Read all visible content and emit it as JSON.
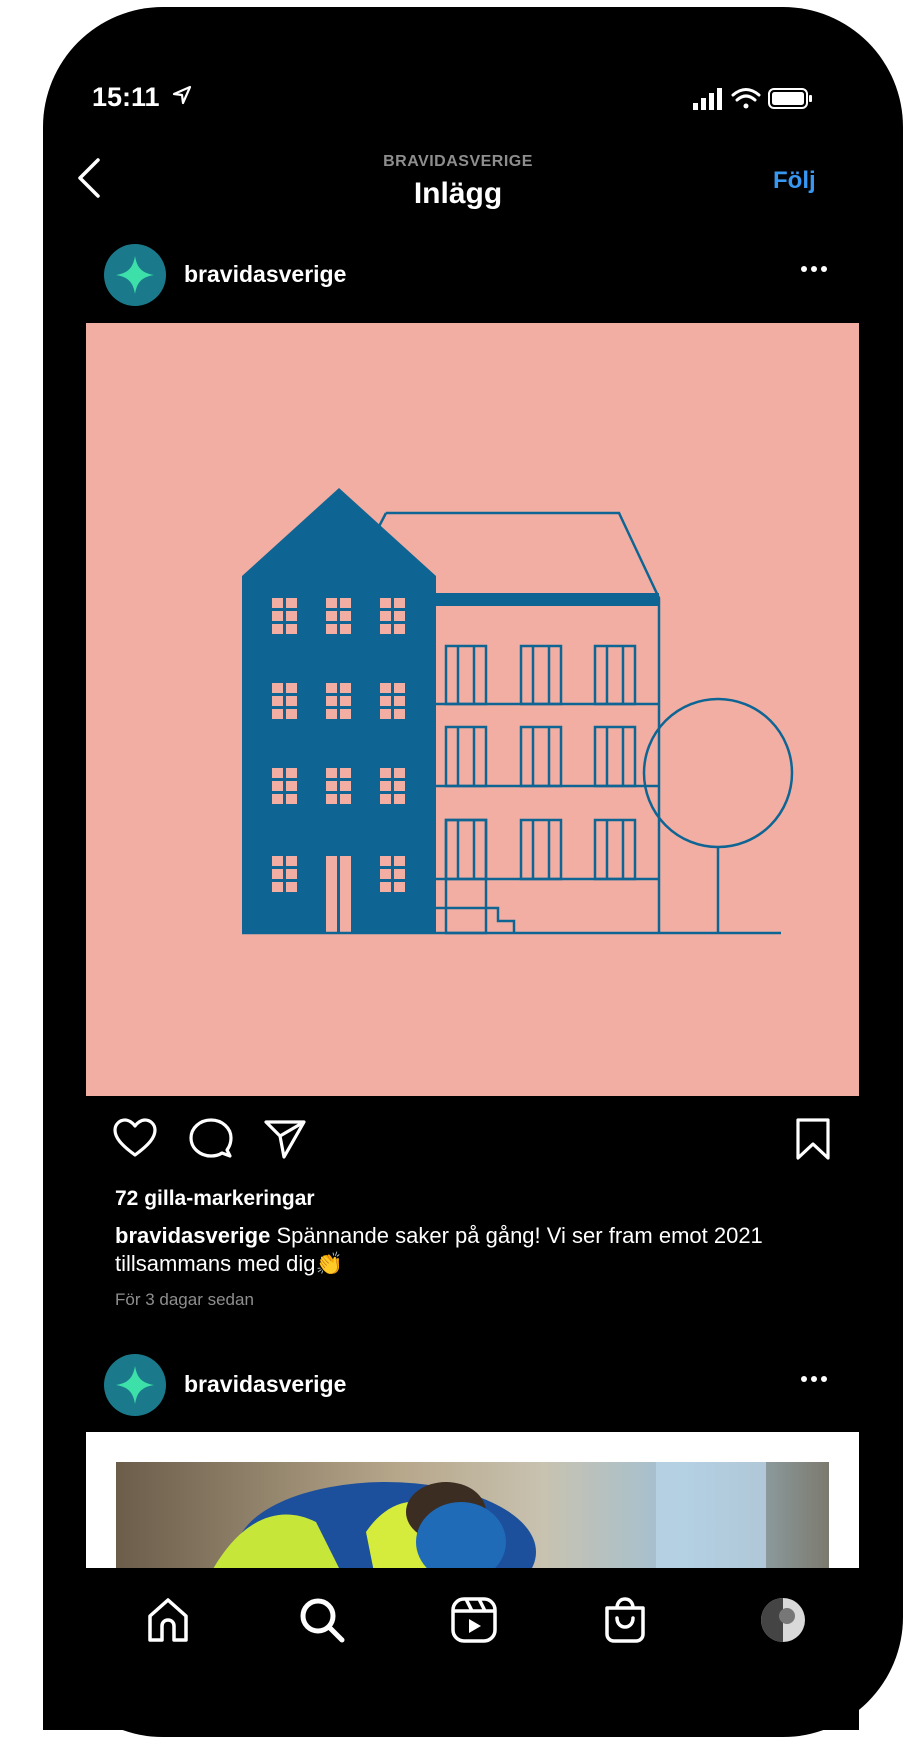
{
  "status_bar": {
    "time": "15:11"
  },
  "header": {
    "subtitle": "BRAVIDASVERIGE",
    "title": "Inlägg",
    "follow_label": "Följ"
  },
  "post1": {
    "username": "bravidasverige",
    "likes": "72 gilla-markeringar",
    "caption_user": "bravidasverige",
    "caption_text": "Spännande saker på gång! Vi ser fram emot 2021 tillsammans med dig👏",
    "time_ago": "För 3 dagar sedan"
  },
  "post2": {
    "username": "bravidasverige"
  },
  "colors": {
    "accent": "#3897f0",
    "illustration_bg": "#f2aea2",
    "building_blue": "#0e6594",
    "avatar_teal": "#1a7a8c",
    "avatar_star": "#3de0a8"
  },
  "icons": {
    "status": [
      "location-arrow-icon",
      "signal-icon",
      "wifi-icon",
      "battery-icon"
    ],
    "actions": [
      "heart-icon",
      "comment-icon",
      "share-icon",
      "bookmark-icon"
    ],
    "tabbar": [
      "home-icon",
      "search-icon",
      "reels-icon",
      "shop-icon",
      "profile-avatar"
    ]
  }
}
